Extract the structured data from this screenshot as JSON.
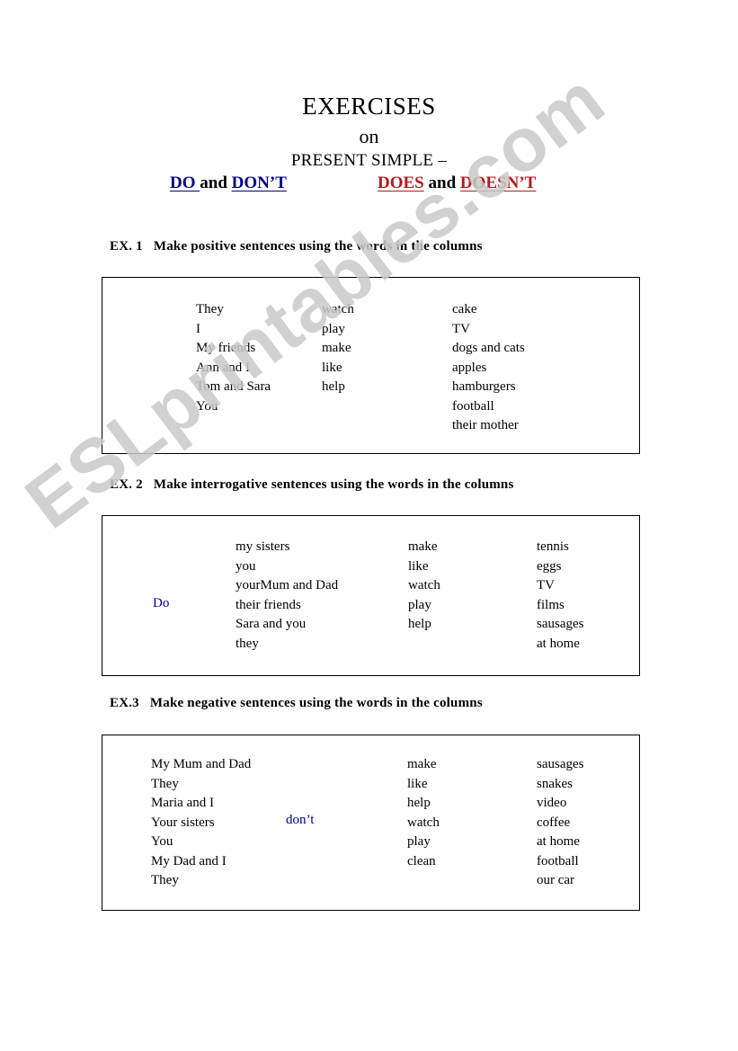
{
  "watermark": {
    "text": "ESLprintables.com"
  },
  "title": {
    "main": "EXERCISES",
    "on": "on",
    "subtitle": "PRESENT  SIMPLE –"
  },
  "aux_header": {
    "blue": {
      "lead": "   ",
      "first": "DO ",
      "conjunction": " and ",
      "second": "DON’T",
      "color": "#00008b"
    },
    "red": {
      "first": "DOES",
      "conjunction": " and ",
      "second": "DOESN’T",
      "color": "#b31b1b"
    }
  },
  "exercises": [
    {
      "number": "EX. 1",
      "instruction": "Make positive sentences using the words in the columns",
      "aux": null,
      "columns": [
        [
          "They",
          "I",
          "My friends",
          "Ann and I",
          "Tom and Sara",
          "You"
        ],
        [
          "watch",
          "play",
          "make",
          "like",
          "help"
        ],
        [
          "cake",
          "TV",
          "dogs and cats",
          "apples",
          "hamburgers",
          "football",
          "their mother"
        ]
      ]
    },
    {
      "number": "EX. 2",
      "instruction": "Make interrogative sentences using the words in the columns",
      "aux": "Do",
      "columns": [
        [
          "my sisters",
          "you",
          "yourMum and Dad",
          "their friends",
          "Sara and you",
          "they"
        ],
        [
          "make",
          "like",
          "watch",
          "play",
          "help"
        ],
        [
          "tennis",
          "eggs",
          "TV",
          "films",
          "sausages",
          "at home"
        ]
      ]
    },
    {
      "number": "EX.3",
      "instruction": "Make negative sentences using the words in the columns",
      "aux": "don’t",
      "columns": [
        [
          "My Mum and Dad",
          "They",
          "Maria and I",
          "Your sisters",
          "You",
          "My Dad and I",
          "They"
        ],
        [
          "make",
          "like",
          "help",
          "watch",
          "play",
          "clean"
        ],
        [
          "sausages",
          "snakes",
          "video",
          "coffee",
          "at home",
          "football",
          "our car"
        ]
      ]
    }
  ]
}
